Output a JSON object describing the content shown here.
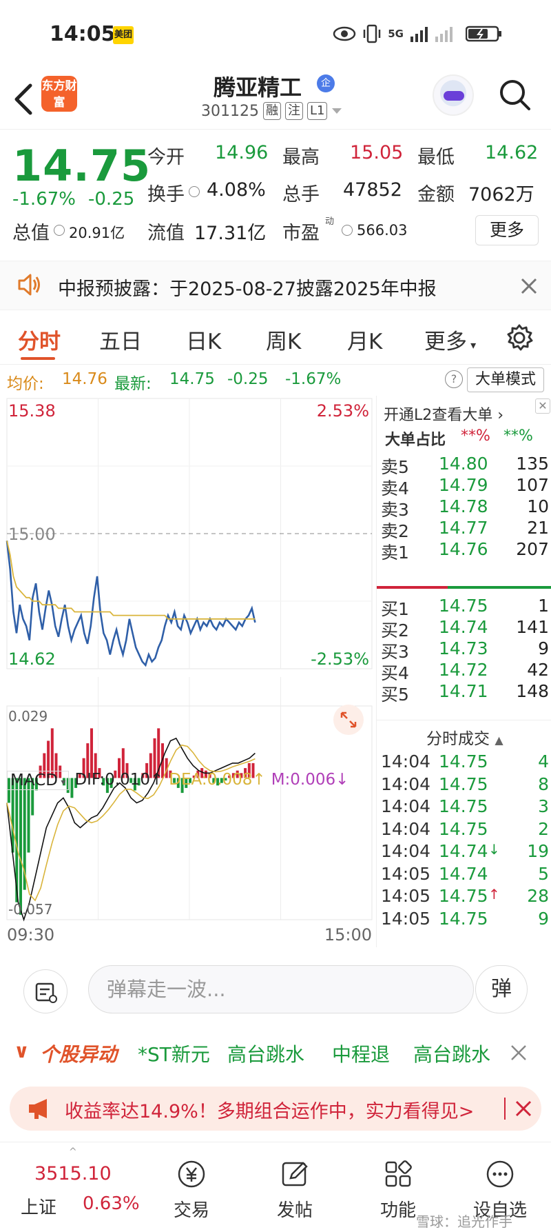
{
  "status_bar": {
    "time": "14:05",
    "app_badge": "美团",
    "network": "5G"
  },
  "header": {
    "logo_text": "东方财富",
    "title": "腾亚精工",
    "title_badge": "企",
    "code": "301125",
    "tags": [
      "融",
      "注",
      "L1"
    ]
  },
  "quote": {
    "price": "14.75",
    "change_pct": "-1.67%",
    "change_abs": "-0.25",
    "open_label": "今开",
    "open": "14.96",
    "high_label": "最高",
    "high": "15.05",
    "low_label": "最低",
    "low": "14.62",
    "turnover_label": "换手",
    "turnover": "4.08%",
    "volume_label": "总手",
    "volume": "47852",
    "amount_label": "金额",
    "amount": "7062万",
    "mktcap_label": "总值",
    "mktcap": "20.91亿",
    "float_label": "流值",
    "float_cap": "17.31亿",
    "pe_label": "市盈",
    "pe_sup": "动",
    "pe": "566.03",
    "more_label": "更多"
  },
  "notice": {
    "text": "中报预披露：于2025-08-27披露2025年中报"
  },
  "tabs": [
    {
      "label": "分时",
      "active": true
    },
    {
      "label": "五日"
    },
    {
      "label": "日K"
    },
    {
      "label": "周K"
    },
    {
      "label": "月K"
    },
    {
      "label": "更多"
    }
  ],
  "info_bar": {
    "avg_label": "均价:",
    "avg": "14.76",
    "latest_label": "最新:",
    "latest": "14.75",
    "chg": "-0.25",
    "pct": "-1.67%",
    "mode_label": "大单模式",
    "help": "?"
  },
  "chart": {
    "y_high": "15.38",
    "y_high_pct": "2.53%",
    "y_low": "14.62",
    "y_low_pct": "-2.53%",
    "y_mid": "15.00",
    "x_start": "09:30",
    "x_end": "15:00",
    "macd_max": "0.029",
    "macd_min": "-0.057",
    "colors": {
      "price": "#2f5fa8",
      "avg": "#d9b43a",
      "up": "#d0243a",
      "down": "#1a9a3c"
    }
  },
  "chart_data": {
    "type": "line",
    "title": "",
    "ylim": [
      14.62,
      15.38
    ],
    "series": [
      {
        "name": "",
        "values": [
          14.98,
          14.9,
          14.78,
          14.72,
          14.8,
          14.76,
          14.74,
          14.7,
          14.82,
          14.86,
          14.78,
          14.73,
          14.79,
          14.84,
          14.8,
          14.74,
          14.71,
          14.76,
          14.8,
          14.74,
          14.7,
          14.73,
          14.75,
          14.77,
          14.72,
          14.69,
          14.74,
          14.82,
          14.88,
          14.78,
          14.72,
          14.7,
          14.66,
          14.7,
          14.73,
          14.69,
          14.66,
          14.7,
          14.76,
          14.72,
          14.68,
          14.66,
          14.64,
          14.63,
          14.66,
          14.64,
          14.65,
          14.68,
          14.7,
          14.74,
          14.77,
          14.75,
          14.78,
          14.74,
          14.73,
          14.77,
          14.75,
          14.72,
          14.74,
          14.76,
          14.73,
          14.75,
          14.74,
          14.76,
          14.74,
          14.73,
          14.75,
          14.74,
          14.76,
          14.75,
          14.74,
          14.73,
          14.75,
          14.74,
          14.76,
          14.77,
          14.79,
          14.75
        ]
      },
      {
        "name": "",
        "values": [
          14.98,
          14.94,
          14.88,
          14.85,
          14.84,
          14.83,
          14.82,
          14.82,
          14.81,
          14.81,
          14.81,
          14.8,
          14.8,
          14.8,
          14.8,
          14.8,
          14.79,
          14.79,
          14.79,
          14.79,
          14.79,
          14.78,
          14.78,
          14.78,
          14.78,
          14.78,
          14.78,
          14.78,
          14.78,
          14.78,
          14.78,
          14.78,
          14.78,
          14.77,
          14.77,
          14.77,
          14.77,
          14.77,
          14.77,
          14.77,
          14.77,
          14.77,
          14.77,
          14.77,
          14.77,
          14.77,
          14.77,
          14.77,
          14.77,
          14.77,
          14.76,
          14.76,
          14.76,
          14.76,
          14.76,
          14.76,
          14.76,
          14.76,
          14.76,
          14.76,
          14.76,
          14.76,
          14.76,
          14.76,
          14.76,
          14.76,
          14.76,
          14.76,
          14.76,
          14.76,
          14.76,
          14.76,
          14.76,
          14.76,
          14.76,
          14.76,
          14.76,
          14.76
        ]
      }
    ],
    "macd": {
      "dif_label": "DIF:0.010",
      "dea_label": "DEA:0.008",
      "m_label": "M:0.006",
      "title": "MACD",
      "bars": [
        -0.01,
        -0.03,
        -0.05,
        -0.055,
        -0.045,
        -0.03,
        -0.015,
        -0.005,
        0.005,
        0.01,
        0.015,
        0.02,
        0.01,
        0.005,
        -0.003,
        -0.006,
        -0.008,
        -0.004,
        0.002,
        0.008,
        0.014,
        0.02,
        0.01,
        0.004,
        -0.003,
        -0.006,
        -0.004,
        0.003,
        0.008,
        0.012,
        0.006,
        -0.002,
        -0.005,
        -0.003,
        0.002,
        0.006,
        0.01,
        0.016,
        0.02,
        0.014,
        0.008,
        0.003,
        -0.002,
        -0.004,
        -0.006,
        -0.004,
        -0.002,
        0.001,
        0.003,
        0.004,
        0.003,
        0.002,
        -0.002,
        -0.003,
        -0.002,
        -0.001,
        0.001,
        0.002,
        0.003,
        0.002,
        0.004,
        0.006,
        0.006
      ],
      "dif": [
        -0.01,
        -0.03,
        -0.05,
        -0.057,
        -0.05,
        -0.04,
        -0.03,
        -0.02,
        -0.015,
        -0.01,
        -0.008,
        -0.012,
        -0.018,
        -0.02,
        -0.018,
        -0.016,
        -0.015,
        -0.012,
        -0.008,
        -0.004,
        -0.002,
        -0.004,
        -0.008,
        -0.01,
        -0.009,
        -0.006,
        -0.002,
        0.004,
        0.01,
        0.015,
        0.016,
        0.012,
        0.008,
        0.005,
        0.003,
        0.002,
        0.002,
        0.003,
        0.004,
        0.005,
        0.006,
        0.006,
        0.007,
        0.008,
        0.01
      ]
    }
  },
  "order_book": {
    "l2_label": "开通L2查看大单",
    "big_ratio_label": "大单占比",
    "big_ratio_sell": "**%",
    "big_ratio_buy": "**%",
    "asks": [
      {
        "label": "卖5",
        "price": "14.80",
        "vol": "135"
      },
      {
        "label": "卖4",
        "price": "14.79",
        "vol": "107"
      },
      {
        "label": "卖3",
        "price": "14.78",
        "vol": "10"
      },
      {
        "label": "卖2",
        "price": "14.77",
        "vol": "21"
      },
      {
        "label": "卖1",
        "price": "14.76",
        "vol": "207"
      }
    ],
    "bids": [
      {
        "label": "买1",
        "price": "14.75",
        "vol": "1"
      },
      {
        "label": "买2",
        "price": "14.74",
        "vol": "141"
      },
      {
        "label": "买3",
        "price": "14.73",
        "vol": "9"
      },
      {
        "label": "买4",
        "price": "14.72",
        "vol": "42"
      },
      {
        "label": "买5",
        "price": "14.71",
        "vol": "148"
      }
    ],
    "ticks_label": "分时成交",
    "ticks": [
      {
        "time": "14:04",
        "price": "14.75",
        "vol": "4",
        "arrow": ""
      },
      {
        "time": "14:04",
        "price": "14.75",
        "vol": "8",
        "arrow": ""
      },
      {
        "time": "14:04",
        "price": "14.75",
        "vol": "3",
        "arrow": ""
      },
      {
        "time": "14:04",
        "price": "14.75",
        "vol": "2",
        "arrow": ""
      },
      {
        "time": "14:04",
        "price": "14.74",
        "vol": "19",
        "arrow": "↓"
      },
      {
        "time": "14:05",
        "price": "14.74",
        "vol": "5",
        "arrow": ""
      },
      {
        "time": "14:05",
        "price": "14.75",
        "vol": "28",
        "arrow": "↑"
      },
      {
        "time": "14:05",
        "price": "14.75",
        "vol": "9",
        "arrow": ""
      }
    ]
  },
  "danmaku": {
    "placeholder": "弹幕走一波...",
    "send_label": "弹"
  },
  "alerts": {
    "title": "个股异动",
    "items": [
      "*ST新元",
      "高台跳水",
      "中程退",
      "高台跳水"
    ]
  },
  "promo": {
    "text": "收益率达14.9%！多期组合运作中，实力看得见>"
  },
  "bottom_nav": {
    "index_value": "3515.10",
    "index_name": "上证",
    "index_pct": "0.63%",
    "items": [
      "交易",
      "发帖",
      "功能",
      "设自选"
    ]
  },
  "watermark": "雪球：追光作手"
}
